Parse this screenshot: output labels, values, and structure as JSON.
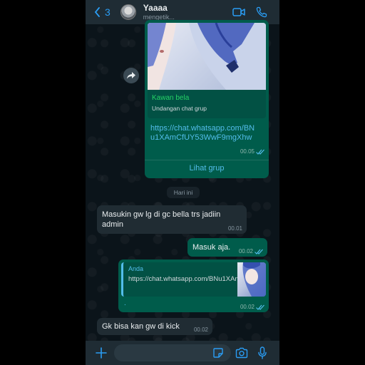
{
  "header": {
    "back_count": "3",
    "contact_name": "Yaaaa",
    "status": "mengetik..."
  },
  "messages": {
    "invite": {
      "group_name": "Kawan bela",
      "subtitle": "Undangan chat grup",
      "link": "https://chat.whatsapp.com/BNu1XAmCfUY53WwF9mgXhw",
      "time": "00.05",
      "action": "Lihat grup"
    },
    "day_separator": "Hari ini",
    "in1": {
      "text": "Masukin gw lg di gc bella trs jadiin admin",
      "time": "00.01"
    },
    "out1": {
      "text": "Masuk aja.",
      "time": "00.02"
    },
    "out2": {
      "quote_author": "Anda",
      "quote_text": "https://chat.whatsapp.com/BNu1XAmCfUY53WwF9mgXhw",
      "body": ".",
      "time": "00.02"
    },
    "in2": {
      "text": "Gk bisa kan gw di kick",
      "time": "00.02"
    }
  },
  "input": {
    "placeholder": "",
    "value": ""
  },
  "icons": {
    "back": "chevron-left-icon",
    "video": "video-call-icon",
    "phone": "phone-icon",
    "forward": "forward-icon",
    "plus": "plus-icon",
    "sticker": "sticker-icon",
    "camera": "camera-icon",
    "mic": "microphone-icon",
    "read": "double-check-icon"
  },
  "colors": {
    "accent": "#2a9df4",
    "outgoing_bubble": "#005c4b",
    "incoming_bubble": "#202c33",
    "link": "#53bdeb",
    "group_name": "#25d366",
    "background": "#0b141a"
  }
}
